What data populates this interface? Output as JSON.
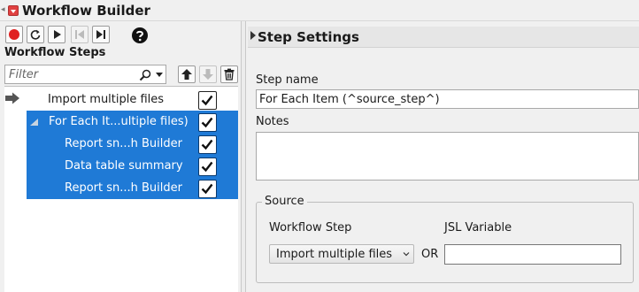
{
  "window": {
    "title": "Workflow Builder"
  },
  "toolbar": {
    "buttons": [
      {
        "name": "record-button",
        "icon": "record-icon",
        "color": "#e02020",
        "enabled": true
      },
      {
        "name": "reset-button",
        "icon": "reset-icon",
        "enabled": true
      },
      {
        "name": "play-button",
        "icon": "play-icon",
        "enabled": true
      },
      {
        "name": "step-back-button",
        "icon": "step-back-icon",
        "enabled": false
      },
      {
        "name": "step-forward-button",
        "icon": "step-forward-icon",
        "enabled": true
      },
      {
        "name": "help-button",
        "icon": "help-icon",
        "enabled": true
      }
    ]
  },
  "workflow_steps": {
    "heading": "Workflow Steps",
    "filter": {
      "value": "",
      "placeholder": "Filter"
    },
    "actions": [
      {
        "name": "move-up-button",
        "icon": "arrow-up-icon"
      },
      {
        "name": "move-down-button",
        "icon": "arrow-down-icon",
        "enabled": false
      },
      {
        "name": "delete-step-button",
        "icon": "trash-icon"
      }
    ],
    "items": [
      {
        "label": "Import multiple files",
        "checked": true,
        "selected": false,
        "current": true,
        "level": 0
      },
      {
        "label": "For Each It...ultiple files)",
        "checked": true,
        "selected": true,
        "group": true,
        "level": 0
      },
      {
        "label": "Report sn...h Builder",
        "checked": true,
        "selected": true,
        "level": 1
      },
      {
        "label": "Data table summary",
        "checked": true,
        "selected": true,
        "level": 1
      },
      {
        "label": "Report sn...h Builder",
        "checked": true,
        "selected": true,
        "level": 1
      }
    ],
    "selection_color": "#1f7ad6"
  },
  "step_settings": {
    "title": "Step Settings",
    "step_name_label": "Step name",
    "step_name_value": "For Each Item (^source_step^)",
    "notes_label": "Notes",
    "notes_value": "",
    "source": {
      "legend": "Source",
      "workflow_step_label": "Workflow Step",
      "jsl_variable_label": "JSL Variable",
      "selected_step": "Import multiple files",
      "or_label": "OR",
      "jsl_variable_value": ""
    }
  }
}
